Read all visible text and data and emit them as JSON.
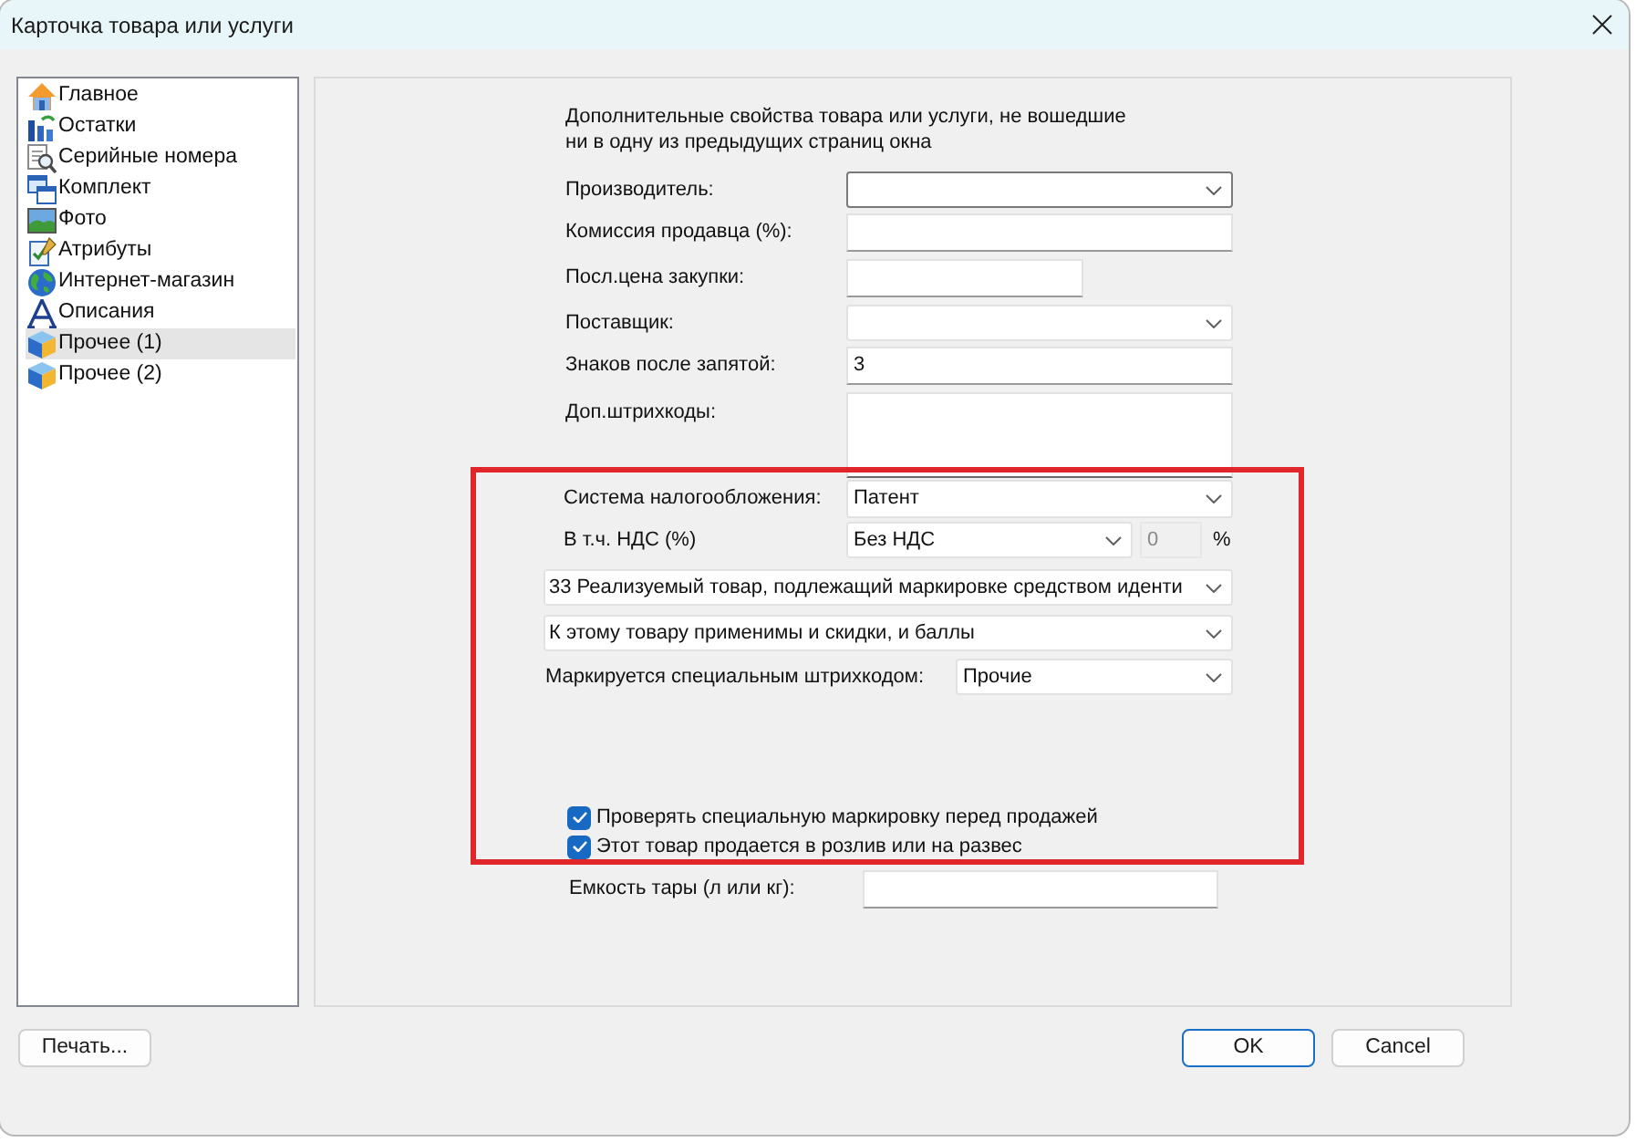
{
  "window": {
    "title": "Карточка товара или услуги"
  },
  "sidebar": {
    "items": [
      {
        "label": "Главное",
        "selected": false
      },
      {
        "label": "Остатки",
        "selected": false
      },
      {
        "label": "Серийные номера",
        "selected": false
      },
      {
        "label": "Комплект",
        "selected": false
      },
      {
        "label": "Фото",
        "selected": false
      },
      {
        "label": "Атрибуты",
        "selected": false
      },
      {
        "label": "Интернет-магазин",
        "selected": false
      },
      {
        "label": "Описания",
        "selected": false
      },
      {
        "label": "Прочее (1)",
        "selected": true
      },
      {
        "label": "Прочее (2)",
        "selected": false
      }
    ]
  },
  "panel": {
    "description": [
      "Дополнительные свойства товара или услуги, не вошедшие",
      "ни в одну из предыдущих страниц окна"
    ],
    "fields": [
      {
        "kind": "select",
        "label": "Производитель:",
        "focused": true
      },
      {
        "kind": "input",
        "label": "Комиссия продавца (%):",
        "focused": false
      },
      {
        "kind": "short_input",
        "label": "Посл.цена закупки:",
        "focused": false
      },
      {
        "kind": "select",
        "label": "Поставщик:",
        "focused": false
      },
      {
        "kind": "input",
        "label": "Знаков после запятой:",
        "value": "3",
        "focused": false
      },
      {
        "kind": "textarea",
        "label": "Доп.штрихкоды:",
        "focused": false
      }
    ],
    "tax_system": {
      "label": "Система налогообложения:",
      "value": "Патент"
    },
    "vat": {
      "label": "В т.ч. НДС (%)",
      "value": "Без НДС",
      "rate": "0",
      "rate_disabled": true,
      "unit": "%"
    },
    "sign_select": {
      "value": "33 Реализуемый товар, подлежащий маркировке средством иденти"
    },
    "bonus_select": {
      "value": "К этому товару применимы и скидки, и баллы"
    },
    "marking": {
      "label": "Маркируется специальным штрихкодом:",
      "value": "Прочие"
    },
    "checkboxes": [
      {
        "label": "Проверять специальную маркировку перед продажей",
        "checked": true
      },
      {
        "label": "Этот товар продается в розлив или на развес",
        "checked": true
      }
    ],
    "container": {
      "label": "Емкость тары (л или кг):"
    }
  },
  "buttons": [
    {
      "label": "Печать...",
      "default": false
    },
    {
      "label": "OK",
      "default": true
    },
    {
      "label": "Cancel",
      "default": false
    }
  ]
}
